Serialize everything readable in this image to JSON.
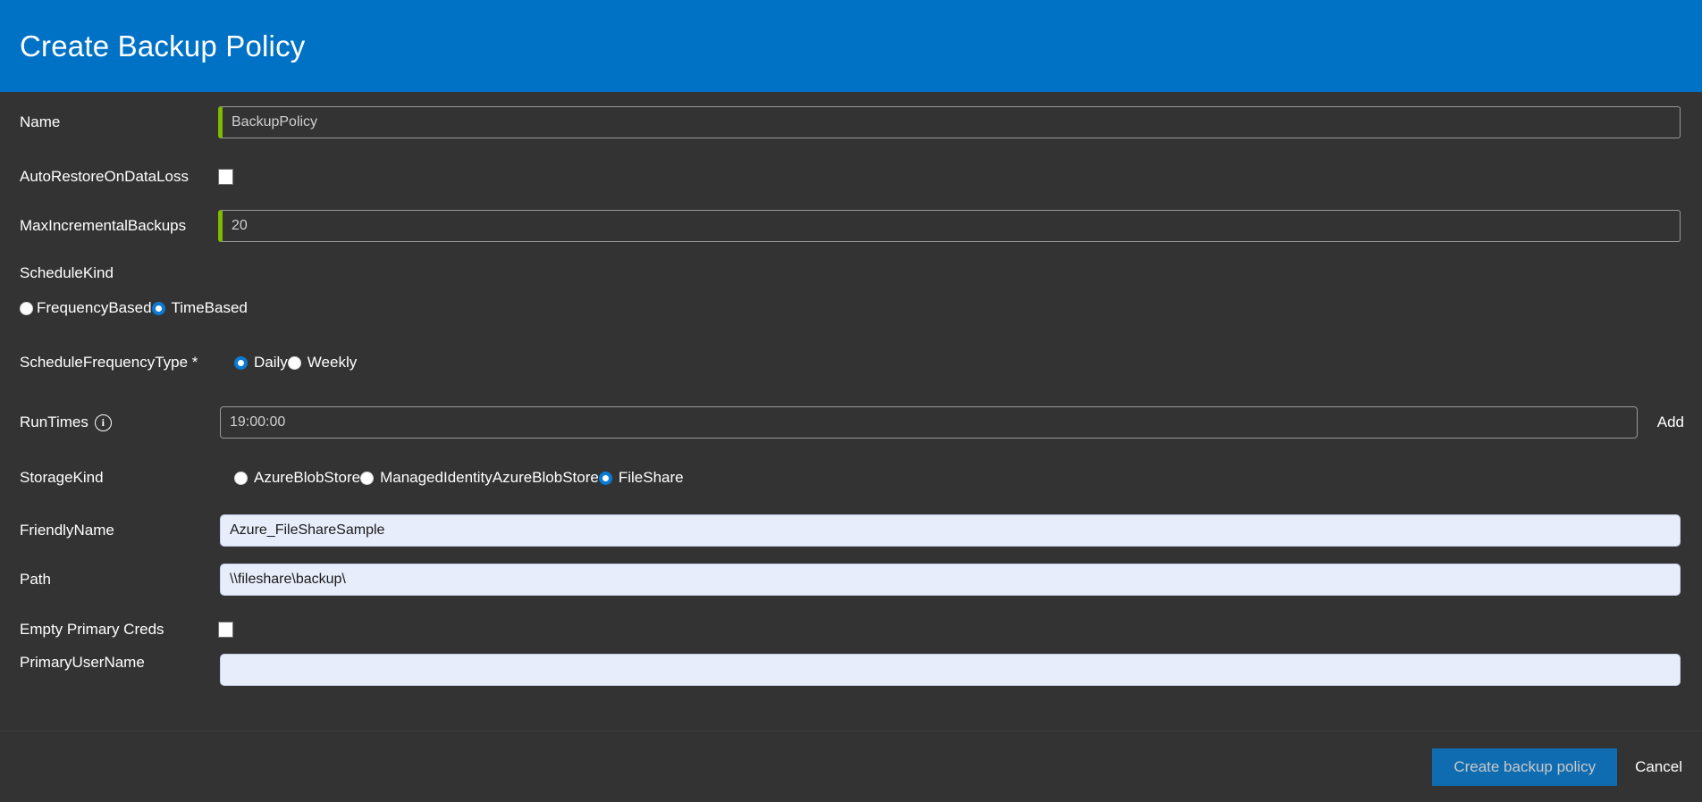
{
  "header": {
    "title": "Create Backup Policy",
    "accent_color": "#0072c6"
  },
  "form": {
    "name": {
      "label": "Name",
      "value": "BackupPolicy",
      "accent_color": "#7fba00"
    },
    "auto_restore": {
      "label": "AutoRestoreOnDataLoss",
      "checked": "false"
    },
    "max_incremental_backups": {
      "label": "MaxIncrementalBackups",
      "value": "20",
      "accent_color": "#7fba00"
    },
    "schedule_kind": {
      "label": "ScheduleKind",
      "options": [
        {
          "label": "FrequencyBased",
          "selected": "false"
        },
        {
          "label": "TimeBased",
          "selected": "true"
        }
      ]
    },
    "schedule_frequency_type": {
      "label": "ScheduleFrequencyType *",
      "options": [
        {
          "label": "Daily",
          "selected": "true"
        },
        {
          "label": "Weekly",
          "selected": "false"
        }
      ]
    },
    "run_times": {
      "label": "RunTimes",
      "info_icon": "info-icon",
      "value": "19:00:00",
      "add_label": "Add"
    },
    "storage_kind": {
      "label": "StorageKind",
      "options": [
        {
          "label": "AzureBlobStore",
          "selected": "false"
        },
        {
          "label": "ManagedIdentityAzureBlobStore",
          "selected": "false"
        },
        {
          "label": "FileShare",
          "selected": "true"
        }
      ]
    },
    "friendly_name": {
      "label": "FriendlyName",
      "value": "Azure_FileShareSample"
    },
    "path": {
      "label": "Path",
      "value": "\\\\fileshare\\backup\\"
    },
    "empty_primary_creds": {
      "label": "Empty Primary Creds",
      "checked": "false"
    },
    "primary_user_name": {
      "label": "PrimaryUserName",
      "value": ""
    }
  },
  "footer": {
    "submit_label": "Create backup policy",
    "cancel_label": "Cancel",
    "submit_color": "#0f6cb0"
  }
}
